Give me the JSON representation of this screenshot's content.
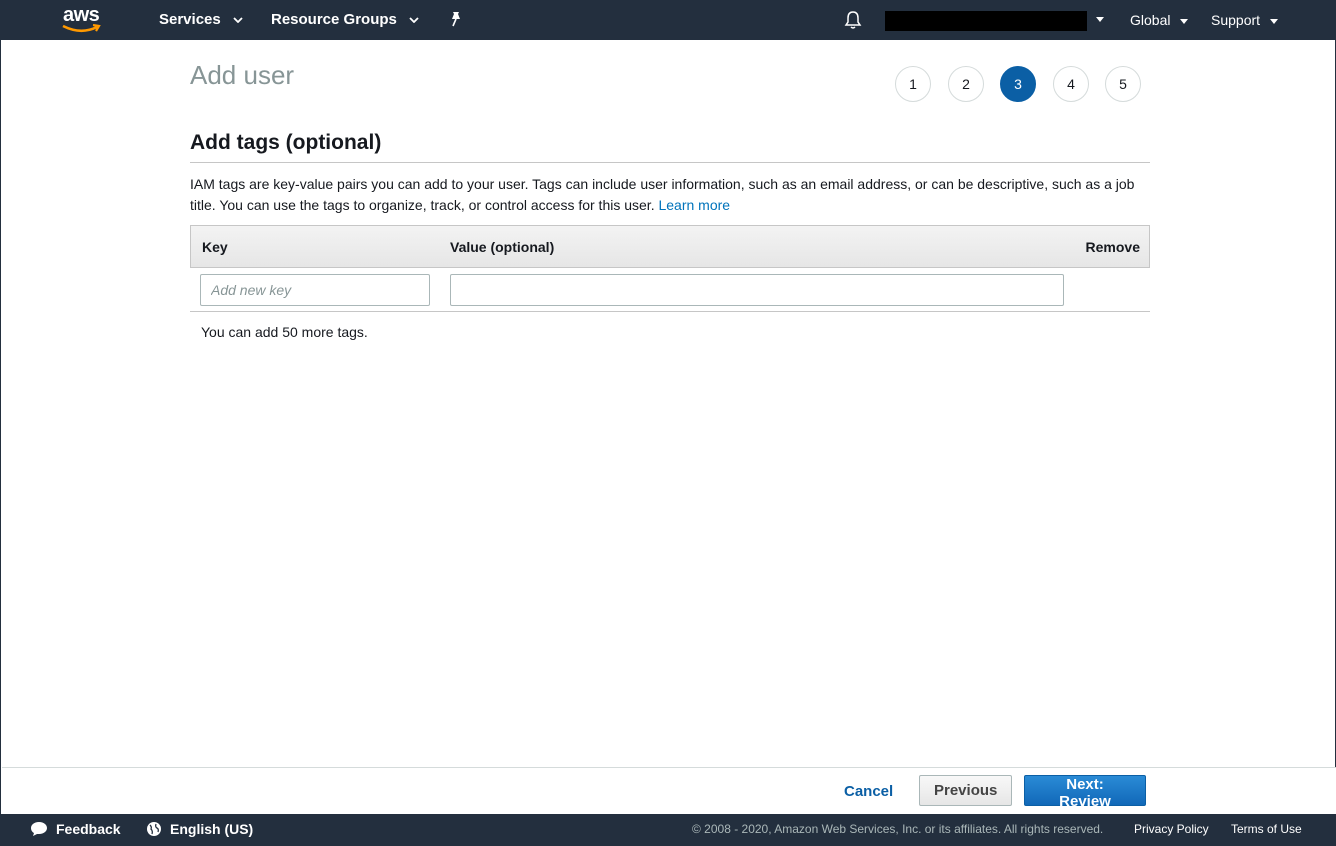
{
  "topnav": {
    "logo_text": "aws",
    "services_label": "Services",
    "resource_groups_label": "Resource Groups",
    "region_label": "Global",
    "support_label": "Support"
  },
  "page": {
    "title": "Add user",
    "steps": [
      "1",
      "2",
      "3",
      "4",
      "5"
    ],
    "active_step": "3"
  },
  "section": {
    "title": "Add tags (optional)",
    "description": "IAM tags are key-value pairs you can add to your user. Tags can include user information, such as an email address, or can be descriptive, such as a job title. You can use the tags to organize, track, or control access for this user.",
    "learn_more": "Learn more"
  },
  "tags_table": {
    "headers": {
      "key": "Key",
      "value": "Value (optional)",
      "remove": "Remove"
    },
    "key_placeholder": "Add new key",
    "key_value": "",
    "value_value": "",
    "note": "You can add 50 more tags."
  },
  "actions": {
    "cancel": "Cancel",
    "previous": "Previous",
    "next": "Next: Review"
  },
  "footer": {
    "feedback": "Feedback",
    "language": "English (US)",
    "copyright": "© 2008 - 2020, Amazon Web Services, Inc. or its affiliates. All rights reserved.",
    "privacy": "Privacy Policy",
    "terms": "Terms of Use"
  },
  "colors": {
    "nav_bg": "#232f3e",
    "accent": "#0b5fa5",
    "link": "#0073bb"
  }
}
